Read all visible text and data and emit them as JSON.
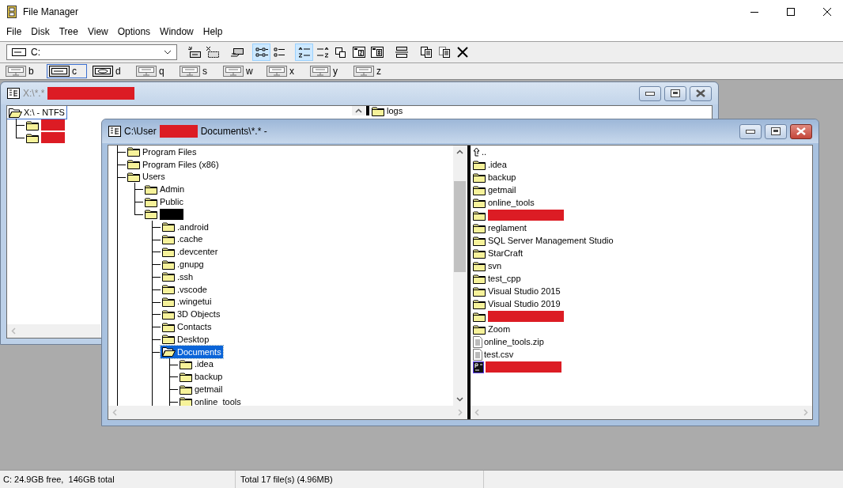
{
  "window": {
    "title": "File Manager"
  },
  "menu": [
    "File",
    "Disk",
    "Tree",
    "View",
    "Options",
    "Window",
    "Help"
  ],
  "drive_select": {
    "value": "C:"
  },
  "toolbar": [
    [
      {
        "kind": "connect",
        "selected": false
      },
      {
        "kind": "disconnect",
        "selected": false
      }
    ],
    [
      {
        "kind": "share",
        "selected": false
      }
    ],
    [
      {
        "kind": "names",
        "selected": true
      },
      {
        "kind": "details",
        "selected": false
      }
    ],
    [
      {
        "kind": "sort-name",
        "selected": true
      },
      {
        "kind": "sort-type",
        "selected": false
      },
      {
        "kind": "new-window",
        "selected": false
      },
      {
        "kind": "card-z",
        "selected": false
      },
      {
        "kind": "card-b",
        "selected": false
      }
    ],
    [
      {
        "kind": "split",
        "selected": false
      }
    ],
    [
      {
        "kind": "copy",
        "selected": false
      },
      {
        "kind": "paste",
        "selected": false
      },
      {
        "kind": "delete",
        "selected": false
      }
    ]
  ],
  "drives": [
    {
      "letter": "b",
      "kind": "network",
      "selected": false
    },
    {
      "letter": "c",
      "kind": "fixed",
      "selected": true
    },
    {
      "letter": "d",
      "kind": "cdrom",
      "selected": false
    },
    {
      "letter": "q",
      "kind": "network",
      "selected": false
    },
    {
      "letter": "s",
      "kind": "network",
      "selected": false
    },
    {
      "letter": "w",
      "kind": "network",
      "selected": false
    },
    {
      "letter": "x",
      "kind": "network",
      "selected": false
    },
    {
      "letter": "y",
      "kind": "network",
      "selected": false
    },
    {
      "letter": "z",
      "kind": "network",
      "selected": false
    }
  ],
  "child_windows": [
    {
      "active": false,
      "title_parts": [
        {
          "kind": "text",
          "text": "X:\\*.*"
        },
        {
          "kind": "redacted",
          "color": "#dc1c24"
        }
      ],
      "tree": {
        "items": [
          {
            "kind": "drive",
            "label": "X:\\ - NTFS",
            "selected": true,
            "children_continue": false,
            "children": [
              {
                "redacted": true,
                "color": "#dc1c24",
                "selected": false
              },
              {
                "redacted": true,
                "color": "#dc1c24",
                "selected": false
              }
            ]
          }
        ]
      },
      "files": [
        {
          "kind": "folder",
          "label": "logs",
          "selected": false
        }
      ]
    },
    {
      "active": true,
      "title_parts": [
        {
          "kind": "text",
          "text": "C:\\User"
        },
        {
          "kind": "redacted",
          "color": "#dc1c24"
        },
        {
          "kind": "text",
          "text": "Documents\\*.* -"
        }
      ],
      "tree": {
        "continues": true,
        "items": [
          {
            "label": "Program Files",
            "selected": false
          },
          {
            "label": "Program Files (x86)",
            "selected": false
          },
          {
            "label": "Users",
            "selected": false,
            "children_continue": false,
            "children": [
              {
                "label": "Admin",
                "selected": false
              },
              {
                "label": "Public",
                "selected": false
              },
              {
                "redacted": true,
                "color": "#000000",
                "selected": false,
                "children_continue": true,
                "children": [
                  {
                    "label": ".android",
                    "selected": false
                  },
                  {
                    "label": ".cache",
                    "selected": false
                  },
                  {
                    "label": ".devcenter",
                    "selected": false
                  },
                  {
                    "label": ".gnupg",
                    "selected": false
                  },
                  {
                    "label": ".ssh",
                    "selected": false
                  },
                  {
                    "label": ".vscode",
                    "selected": false
                  },
                  {
                    "label": ".wingetui",
                    "selected": false
                  },
                  {
                    "label": "3D Objects",
                    "selected": false
                  },
                  {
                    "label": "Contacts",
                    "selected": false
                  },
                  {
                    "label": "Desktop",
                    "selected": false
                  },
                  {
                    "label": "Documents",
                    "selected": true,
                    "children_continue": true,
                    "children": [
                      {
                        "label": ".idea",
                        "selected": false
                      },
                      {
                        "label": "backup",
                        "selected": false
                      },
                      {
                        "label": "getmail",
                        "selected": false
                      },
                      {
                        "label": "online_tools",
                        "selected": false
                      }
                    ]
                  }
                ]
              }
            ]
          }
        ]
      },
      "files": [
        {
          "kind": "up",
          "label": "..",
          "selected": false
        },
        {
          "kind": "folder",
          "label": ".idea",
          "selected": false
        },
        {
          "kind": "folder",
          "label": "backup",
          "selected": false
        },
        {
          "kind": "folder",
          "label": "getmail",
          "selected": false
        },
        {
          "kind": "folder",
          "label": "online_tools",
          "selected": false
        },
        {
          "kind": "folder",
          "redacted": true,
          "color": "#dc1c24",
          "selected": false
        },
        {
          "kind": "folder",
          "label": "reglament",
          "selected": false
        },
        {
          "kind": "folder",
          "label": "SQL Server Management Studio",
          "selected": false
        },
        {
          "kind": "folder",
          "label": "StarCraft",
          "selected": false
        },
        {
          "kind": "folder",
          "label": "svn",
          "selected": false
        },
        {
          "kind": "folder",
          "label": "test_cpp",
          "selected": false
        },
        {
          "kind": "folder",
          "label": "Visual Studio 2015",
          "selected": false
        },
        {
          "kind": "folder",
          "label": "Visual Studio 2019",
          "selected": false
        },
        {
          "kind": "folder",
          "redacted": true,
          "color": "#dc1c24",
          "selected": false
        },
        {
          "kind": "folder",
          "label": "Zoom",
          "selected": false
        },
        {
          "kind": "file",
          "label": "online_tools.zip",
          "selected": false
        },
        {
          "kind": "file",
          "label": "test.csv",
          "selected": false
        },
        {
          "kind": "app",
          "redacted": true,
          "color": "#dc1c24",
          "selected": false
        }
      ]
    }
  ],
  "status_bar": [
    "C: 24.9GB free,  146GB total",
    "Total 17 file(s) (4.96MB)"
  ]
}
